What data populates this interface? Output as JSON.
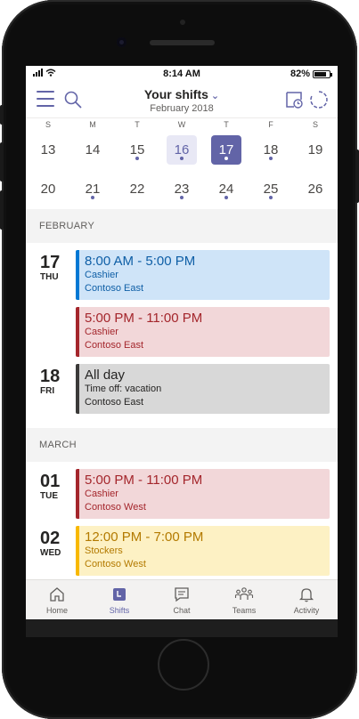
{
  "status_bar": {
    "time": "8:14 AM",
    "battery": "82%",
    "battery_level": 0.82
  },
  "header": {
    "title": "Your shifts",
    "subtitle": "February 2018"
  },
  "calendar": {
    "weekdays": [
      "S",
      "M",
      "T",
      "W",
      "T",
      "F",
      "S"
    ],
    "weeks": [
      [
        {
          "day": "13",
          "dot": false,
          "state": ""
        },
        {
          "day": "14",
          "dot": false,
          "state": ""
        },
        {
          "day": "15",
          "dot": true,
          "state": ""
        },
        {
          "day": "16",
          "dot": true,
          "state": "today"
        },
        {
          "day": "17",
          "dot": true,
          "state": "selected"
        },
        {
          "day": "18",
          "dot": true,
          "state": ""
        },
        {
          "day": "19",
          "dot": false,
          "state": ""
        }
      ],
      [
        {
          "day": "20",
          "dot": false,
          "state": ""
        },
        {
          "day": "21",
          "dot": true,
          "state": ""
        },
        {
          "day": "22",
          "dot": false,
          "state": ""
        },
        {
          "day": "23",
          "dot": true,
          "state": ""
        },
        {
          "day": "24",
          "dot": true,
          "state": ""
        },
        {
          "day": "25",
          "dot": true,
          "state": ""
        },
        {
          "day": "26",
          "dot": false,
          "state": ""
        }
      ]
    ]
  },
  "months": [
    {
      "name": "FEBRUARY",
      "days": [
        {
          "num": "17",
          "dow": "THU",
          "shifts": [
            {
              "time": "8:00 AM - 5:00 PM",
              "line1": "Cashier",
              "line2": "Contoso East",
              "theme": "blue"
            },
            {
              "time": "5:00 PM - 11:00 PM",
              "line1": "Cashier",
              "line2": "Contoso East",
              "theme": "red"
            }
          ]
        },
        {
          "num": "18",
          "dow": "FRI",
          "shifts": [
            {
              "time": "All day",
              "line1": "Time off: vacation",
              "line2": "Contoso East",
              "theme": "gray"
            }
          ]
        }
      ]
    },
    {
      "name": "MARCH",
      "days": [
        {
          "num": "01",
          "dow": "TUE",
          "shifts": [
            {
              "time": "5:00 PM - 11:00 PM",
              "line1": "Cashier",
              "line2": "Contoso West",
              "theme": "red"
            }
          ]
        },
        {
          "num": "02",
          "dow": "WED",
          "shifts": [
            {
              "time": "12:00 PM - 7:00 PM",
              "line1": "Stockers",
              "line2": "Contoso West",
              "theme": "yellow"
            }
          ]
        }
      ]
    }
  ],
  "themes": {
    "blue": {
      "bg": "#cfe4f8",
      "bar": "#0078d4",
      "text": "#0f5fa6"
    },
    "red": {
      "bg": "#f2d7d9",
      "bar": "#a4262c",
      "text": "#a4262c"
    },
    "gray": {
      "bg": "#d8d8d8",
      "bar": "#3b3a39",
      "text": "#252423"
    },
    "yellow": {
      "bg": "#fdf1c4",
      "bar": "#f8b800",
      "text": "#b37a00"
    }
  },
  "tabs": [
    {
      "label": "Home",
      "icon": "home-icon",
      "active": false
    },
    {
      "label": "Shifts",
      "icon": "shifts-icon",
      "active": true
    },
    {
      "label": "Chat",
      "icon": "chat-icon",
      "active": false
    },
    {
      "label": "Teams",
      "icon": "teams-icon",
      "active": false
    },
    {
      "label": "Activity",
      "icon": "bell-icon",
      "active": false
    }
  ],
  "colors": {
    "accent": "#6264a7"
  }
}
